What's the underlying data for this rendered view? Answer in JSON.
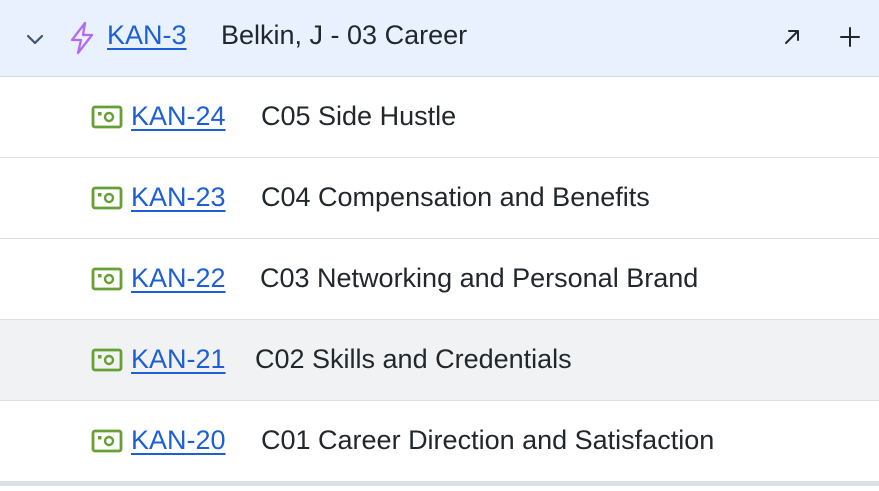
{
  "colors": {
    "link": "#1d5fd6",
    "epic_icon": "#b06df2",
    "story_icon": "#66a035",
    "parent_bg": "#e9f1ff",
    "hover_bg": "#f1f2f4"
  },
  "parent": {
    "chevron_icon": "chevron-down-icon",
    "type_icon": "epic-lightning-icon",
    "key": "KAN-3",
    "summary": "Belkin, J - 03 Career",
    "actions": [
      "open-in-new-icon",
      "plus-icon"
    ]
  },
  "children": [
    {
      "key": "KAN-24",
      "summary": "C05 Side Hustle",
      "type_icon": "story-money-icon"
    },
    {
      "key": "KAN-23",
      "summary": "C04 Compensation and Benefits",
      "type_icon": "story-money-icon"
    },
    {
      "key": "KAN-22",
      "summary": "C03 Networking and Personal Brand",
      "type_icon": "story-money-icon"
    },
    {
      "key": "KAN-21",
      "summary": "C02 Skills and Credentials",
      "type_icon": "story-money-icon"
    },
    {
      "key": "KAN-20",
      "summary": "C01 Career Direction and Satisfaction",
      "type_icon": "story-money-icon"
    }
  ]
}
